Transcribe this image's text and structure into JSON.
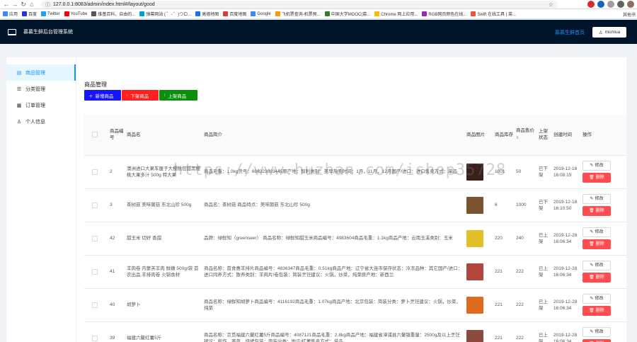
{
  "browser": {
    "url": "127.0.0.1:8083/admin/index.html#/layout/good",
    "bookmarks_label": "应用",
    "bookmarks": [
      {
        "label": "百度",
        "color": "#2932e1"
      },
      {
        "label": "Twitter",
        "color": "#1da1f2"
      },
      {
        "label": "YouTube",
        "color": "#ff0000"
      },
      {
        "label": "维基百科，自由的...",
        "color": "#555555"
      },
      {
        "label": "弹幕网站 ( ゜- ゜)つロ...",
        "color": "#00a1d6"
      },
      {
        "label": "高德地图",
        "color": "#1a73e8"
      },
      {
        "label": "百度地图",
        "color": "#e53935"
      },
      {
        "label": "Google",
        "color": "#4285f4"
      },
      {
        "label": "飞机票查询-机票预...",
        "color": "#ff9800"
      },
      {
        "label": "中国大学MOOC(慕...",
        "color": "#2e7d32"
      },
      {
        "label": "Chrome 网上应用...",
        "color": "#fbbc05"
      },
      {
        "label": "RGB网页颜色在线...",
        "color": "#9c27b0"
      },
      {
        "label": "Swift 在线工具 | 菜...",
        "color": "#f05138"
      }
    ],
    "bookmarks_more": "其他书"
  },
  "header": {
    "title": "慕慕生鲜后台管理系统",
    "home_link": "慕慕生鲜首页",
    "user": "mumua",
    "bg_color": "#001529",
    "accent": "#1890ff"
  },
  "sidebar": {
    "items": [
      {
        "label": "商品管理",
        "icon": "product-icon",
        "active": true
      },
      {
        "label": "分类管理",
        "icon": "list-icon",
        "active": false
      },
      {
        "label": "订单管理",
        "icon": "order-icon",
        "active": false
      },
      {
        "label": "个人信息",
        "icon": "user-icon",
        "active": false
      }
    ]
  },
  "main": {
    "heading": "商品管理",
    "toolbar": {
      "add": "新增商品",
      "off_shelf": "下架商品",
      "on_shelf": "上架商品"
    },
    "columns": {
      "id": "商品编号",
      "name": "商品名",
      "intro": "商品简介",
      "image": "商品图片",
      "stock": "商品库存",
      "price": "商品售价",
      "status": "上架状态",
      "created": "创建时间",
      "actions": "操作"
    },
    "edit_label": "修改",
    "delete_label": "删除",
    "rows": [
      {
        "id": "2",
        "name": "澳洲进口大果车厘子大樱桃包甜黑樱桃大果多汁 500g 特大果",
        "intro": "商品毛重：1.0kg货号：608323093445原产地：智利类别：美早热卖时间：1月，11月，12月国产/进口：进口售卖方式：单品",
        "img_color": "#3a1f1a",
        "stock": "1001",
        "price": "50",
        "status": "已下架",
        "created": "2019-12-18 16:08:15"
      },
      {
        "id": "3",
        "name": "茶树菇 美味菌菇 东北山珍 500g",
        "intro": "商品名：茶树菇 商品特点：美味菌菇 东北山珍 500g",
        "img_color": "#7a5230",
        "stock": "6",
        "price": "1000",
        "status": "已下架",
        "created": "2019-12-18 16:10:50"
      },
      {
        "id": "42",
        "name": "甜玉米 切好 香甜",
        "intro": "品牌：绿鲜知（greenseer） 商品名称：绿鲜知甜玉米商品编号：4983604商品毛重：1.1kg商品产地：云南玉溪类别：玉米",
        "img_color": "#e3c02a",
        "stock": "220",
        "price": "240",
        "status": "已上架",
        "created": "2019-12-28 16:06:34"
      },
      {
        "id": "41",
        "name": "羊肉卷 内蒙羔羊肉 鲜嫩 500g/袋 首农出品 羊排肉卷 火锅食材",
        "intro": "商品名称：首食惠羊排片商品编号：4836347商品毛重：0.51kg商品产地：辽宁省大连市保存状态：冷冻品种：其它国产/进口：进口同养方式：散养类别：羊肉片/卷包装：简装烹饪建议：火锅，炒菜，炖菜原产地：新西兰",
        "img_color": "#b0463c",
        "stock": "221",
        "price": "222",
        "status": "已上架",
        "created": "2019-12-28 16:06:34"
      },
      {
        "id": "40",
        "name": "胡萝卜",
        "intro": "商品名称：绿鲜知胡萝卜商品编号：4116192商品毛重：1.07kg商品产地：北京包装：简装分类：萝卜烹饪建议：火锅，炒菜，炖菜",
        "img_color": "#e06a1c",
        "stock": "221",
        "price": "222",
        "status": "已上架",
        "created": "2019-12-28 16:06:34"
      },
      {
        "id": "39",
        "name": "福建六鳌红薯5斤",
        "intro": "商品名称：京觅福建六鳌红薯5斤商品编号：4087121商品毛重：2.8kg商品产地：福建省漳浦县六鳌镇重量：2500g及以上烹饪建议：煎炸，蒸菜，烧烤包装：简装分类：地瓜/红薯售卖方式：单品",
        "img_color": "#8b4a3b",
        "stock": "221",
        "price": "222",
        "status": "已上架",
        "created": "2019-12-28 16:06:34"
      }
    ]
  },
  "watermark": "https://www.huzhan.com/ishop35728"
}
